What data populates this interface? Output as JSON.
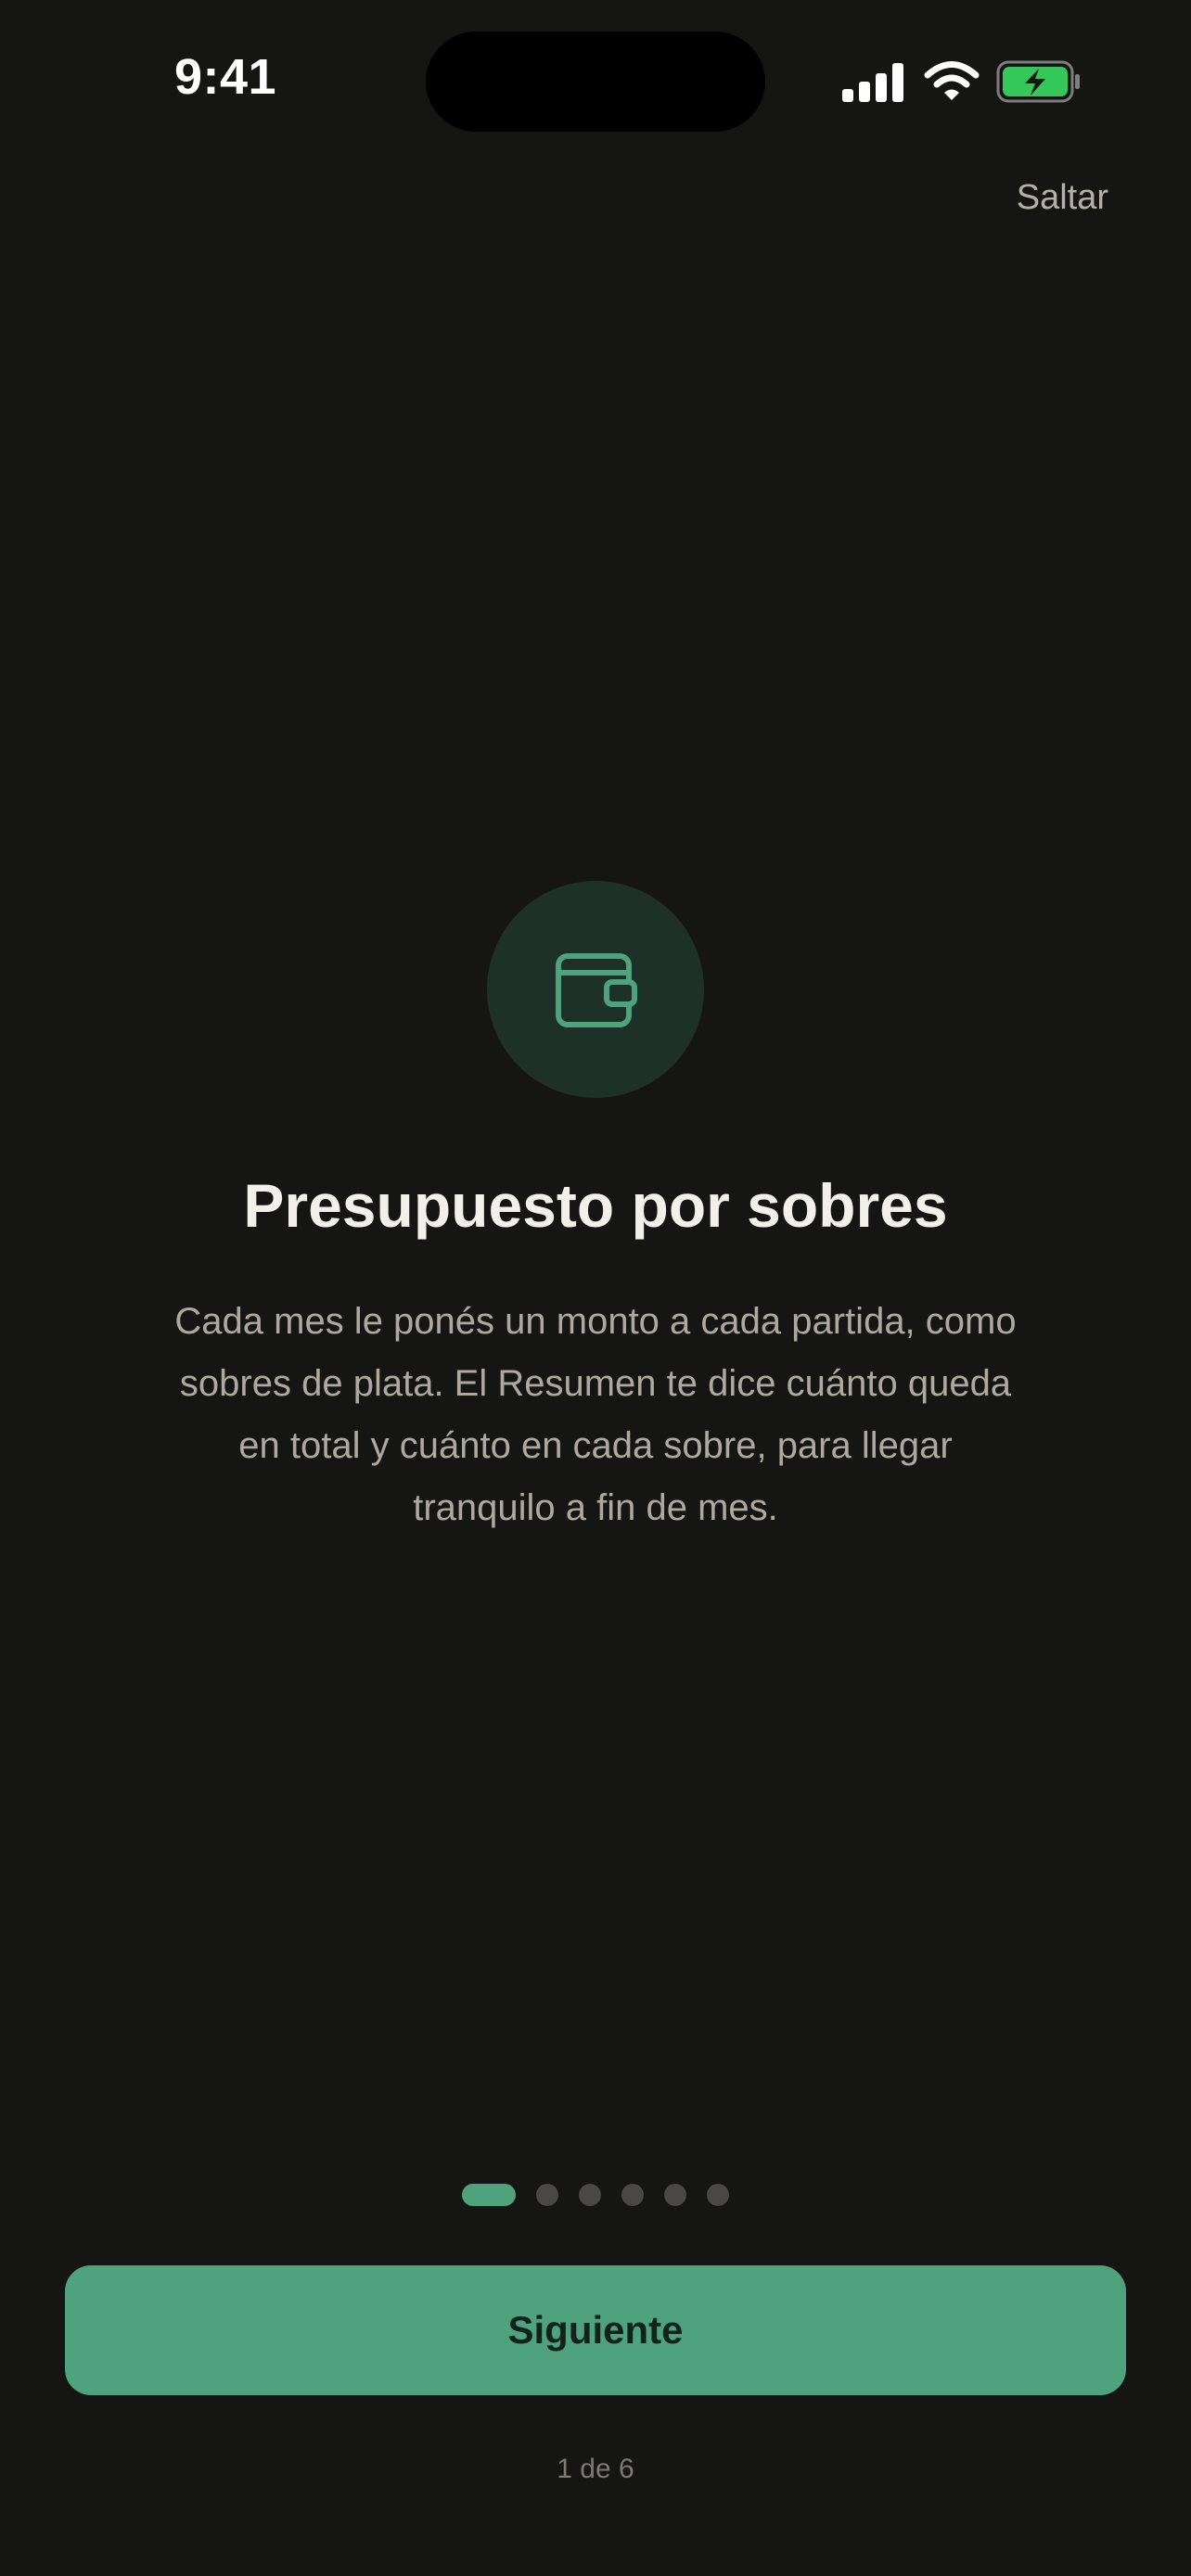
{
  "status_bar": {
    "time": "9:41",
    "icons": [
      "signal-icon",
      "wifi-icon",
      "battery-charging-icon"
    ]
  },
  "header": {
    "skip_label": "Saltar"
  },
  "hero": {
    "icon": "wallet-icon",
    "title": "Presupuesto por sobres",
    "description": "Cada mes le ponés un monto a cada partida, como sobres de plata. El Resumen te dice cuánto queda en total y cuánto en cada sobre, para llegar tranquilo a fin de mes."
  },
  "pager": {
    "current": 1,
    "total": 6
  },
  "footer": {
    "next_label": "Siguiente",
    "step_text": "1 de 6"
  },
  "colors": {
    "background": "#151514",
    "accent": "#4ea37e",
    "icon_circle": "#1e3129",
    "battery": "#35c759"
  }
}
